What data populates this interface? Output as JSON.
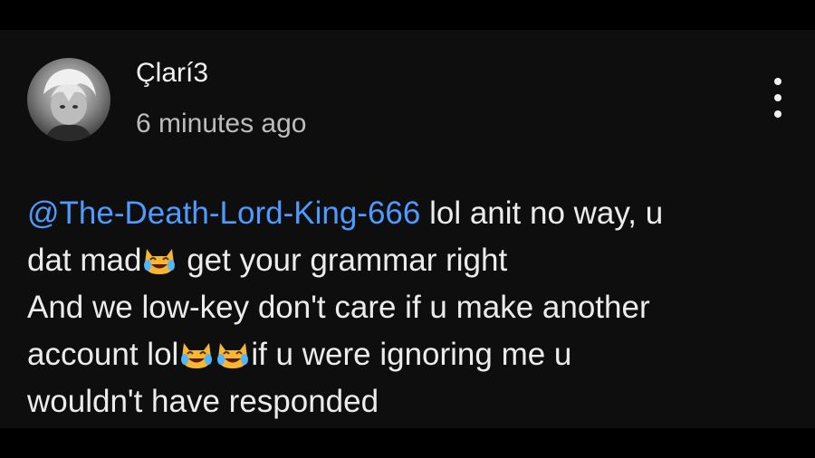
{
  "comment": {
    "author": "Çlarí3",
    "timestamp": "6 minutes ago",
    "mention": "@The-Death-Lord-King-666",
    "lines": [
      " lol anit no way, u",
      "dat mad",
      " get your grammar right",
      "And we low-key don't care if u make another",
      "account lol",
      "if u were ignoring me u",
      "wouldn't have responded"
    ],
    "emoji_name": "cat-with-tears-of-joy-icon"
  },
  "colors": {
    "background": "#0e0e0e",
    "text": "#ececec",
    "mention": "#4d9bff",
    "secondary_text": "#bdbdbd"
  }
}
